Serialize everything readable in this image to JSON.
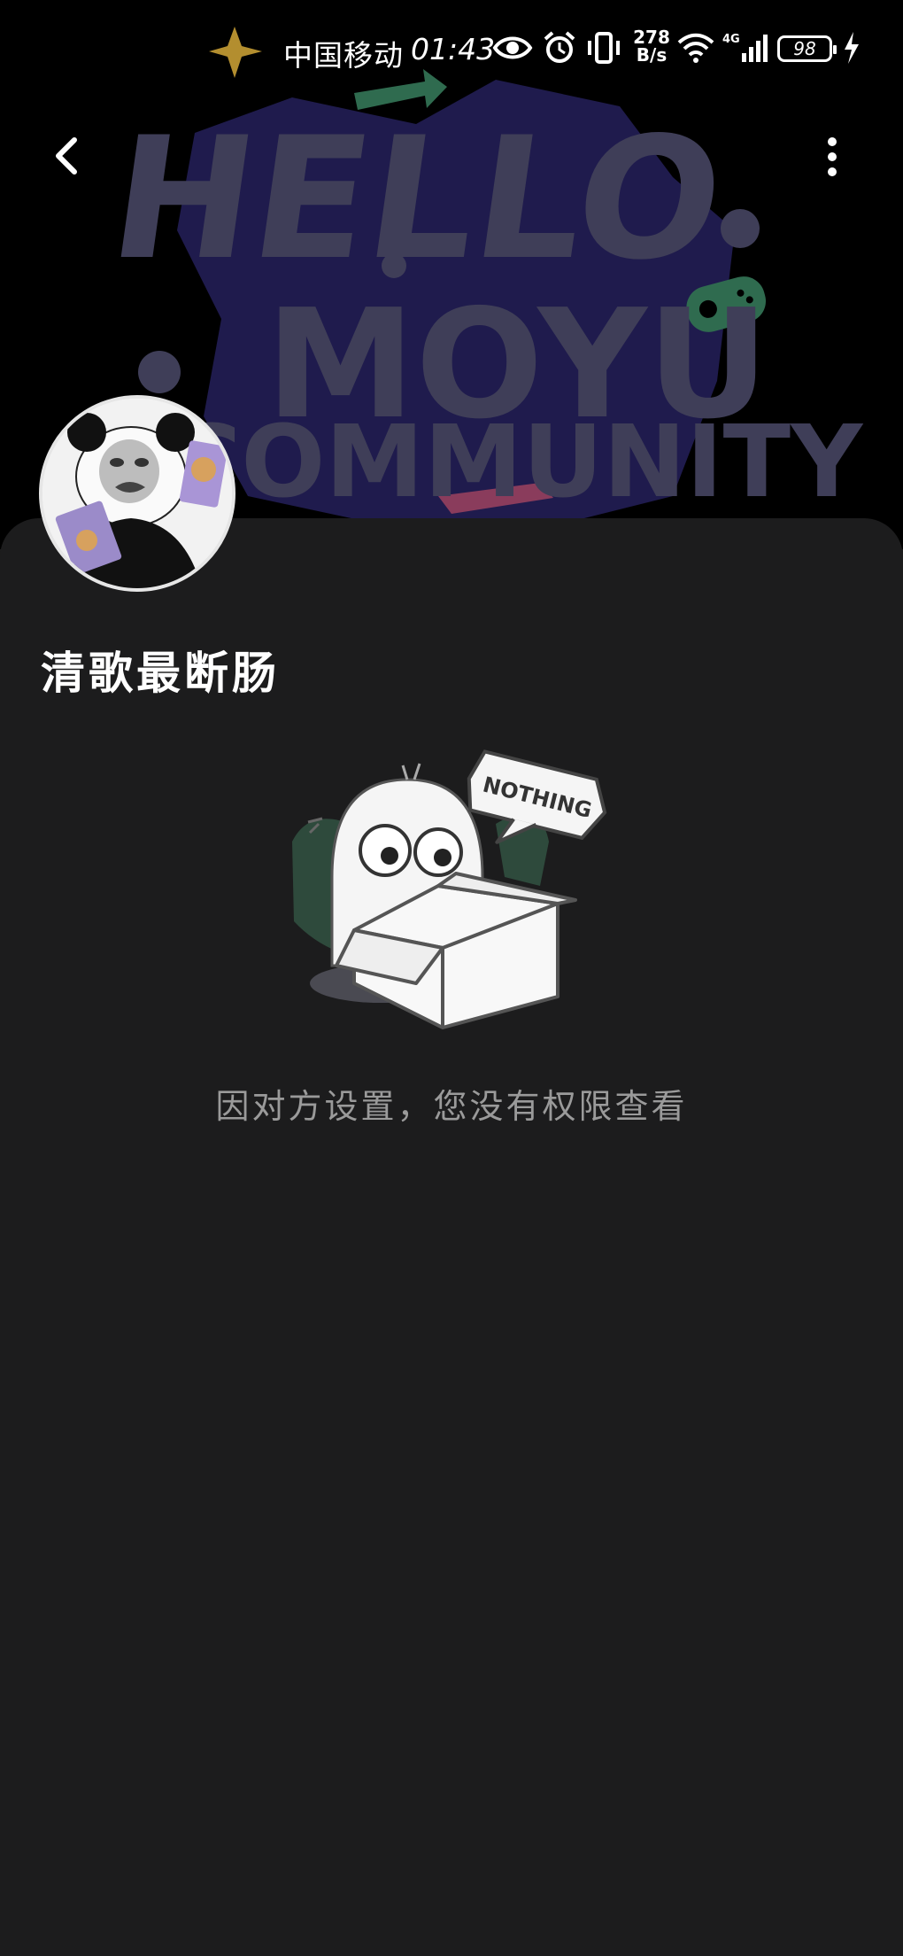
{
  "status_bar": {
    "carrier": "中国移动",
    "time": "01:43",
    "net_speed_value": "278",
    "net_speed_unit": "B/s",
    "network_type": "4G",
    "battery_level": "98",
    "icons": [
      "eye-icon",
      "alarm-icon",
      "vibrate-icon",
      "wifi-icon",
      "signal-icon",
      "battery-icon",
      "charging-icon"
    ]
  },
  "banner": {
    "text_line1": "HELLO",
    "text_line2": "MOYU",
    "text_line3": "COMMUNITY"
  },
  "nav": {
    "back_icon": "chevron-left-icon",
    "more_icon": "more-vertical-icon"
  },
  "profile": {
    "username": "清歌最断肠"
  },
  "empty_state": {
    "bubble_text": "NOTHING",
    "message": "因对方设置，您没有权限查看"
  },
  "colors": {
    "background": "#1c1c1d",
    "banner_text": "#3f3e58",
    "banner_shape": "#1f1b4d",
    "accent_green": "#2f6b4f",
    "accent_pink": "#8a3c5c",
    "accent_gold": "#b38e2f"
  }
}
